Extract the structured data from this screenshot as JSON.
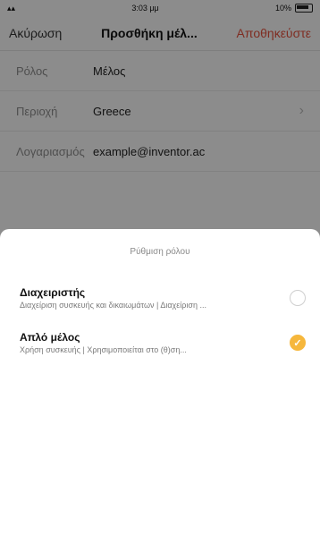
{
  "status_bar": {
    "time": "3:03 μμ",
    "battery": "10%"
  },
  "nav": {
    "left": "Ακύρωση",
    "title": "Προσθήκη μέλ...",
    "right": "Αποθηκεύστε"
  },
  "form": {
    "rows": [
      {
        "label": "Ρόλος",
        "value": "Μέλος"
      },
      {
        "label": "Περιοχή",
        "value": "Greece"
      },
      {
        "label": "Λογαριασμός",
        "value": "example@inventor.ac"
      }
    ]
  },
  "sheet": {
    "title": "Ρύθμιση ρόλου",
    "options": [
      {
        "title": "Διαχειριστής",
        "subtitle": "Διαχείριση συσκευής και δικαιωμάτων | Διαχείριση ...",
        "selected": false
      },
      {
        "title": "Απλό μέλος",
        "subtitle": "Χρήση συσκευής | Χρησιμοποιείται στο (θ)ση...",
        "selected": true
      }
    ]
  },
  "colors": {
    "accent": "#f6b73c",
    "nav_action": "#e8533f"
  }
}
